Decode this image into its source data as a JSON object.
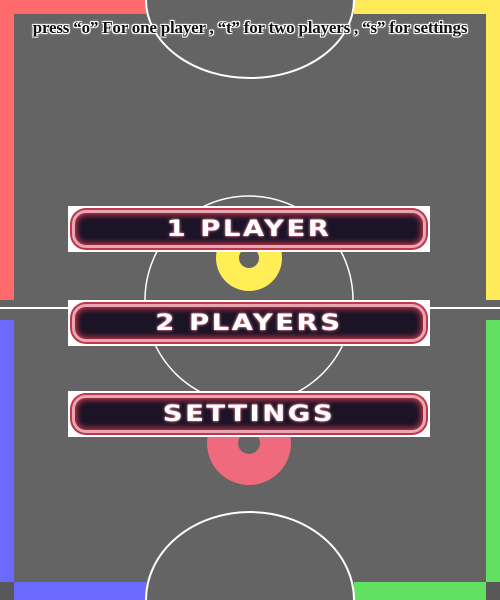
{
  "instruction": "press “o” For one player , “t” for two players , “s” for settings",
  "menu": {
    "one_player": "1 PLAYER",
    "two_players": "2 PLAYERS",
    "settings": "SETTINGS"
  },
  "colors": {
    "field": "#646464",
    "player_red": "#ff6b6b",
    "player_yellow": "#ffeb5a",
    "player_blue": "#6a6aff",
    "player_green": "#62e062",
    "puck_yellow": "#ffee55",
    "puck_pink": "#ee6a7c",
    "lines": "#ffffff"
  }
}
